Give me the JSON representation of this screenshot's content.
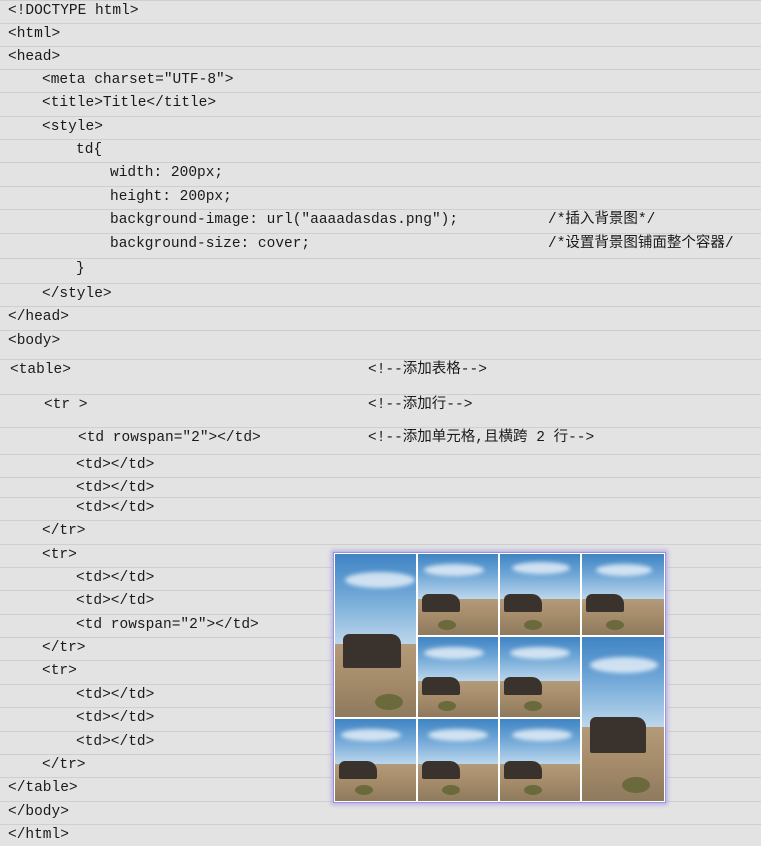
{
  "code_lines": [
    {
      "text": "<!DOCTYPE html>"
    },
    {
      "text": "<html>"
    },
    {
      "text": "<head>"
    },
    {
      "text": "<meta charset=\"UTF-8\">"
    },
    {
      "text": "<title>Title</title>"
    },
    {
      "text": "<style>"
    },
    {
      "text": "td{"
    },
    {
      "text": "width: 200px;"
    },
    {
      "text": "height: 200px;"
    },
    {
      "text": "background-image: url(\"aaaadasdas.png\");",
      "comment": "/*插入背景图*/"
    },
    {
      "text": "background-size: cover;",
      "comment": "/*设置背景图铺面整个容器/"
    },
    {
      "text": "}"
    },
    {
      "text": "</style>"
    },
    {
      "text": "</head>"
    },
    {
      "text": "<body>"
    },
    {
      "text": "<table>",
      "comment": "<!--添加表格-->"
    },
    {
      "text": "<tr >",
      "comment": "<!--添加行-->"
    },
    {
      "text": "<td rowspan=\"2\"></td>",
      "comment": "<!--添加单元格,且横跨 2 行-->"
    },
    {
      "text": "<td></td>"
    },
    {
      "text": "<td></td>"
    },
    {
      "text": "<td></td>"
    },
    {
      "text": "</tr>"
    },
    {
      "text": "<tr>"
    },
    {
      "text": "<td></td>"
    },
    {
      "text": "<td></td>"
    },
    {
      "text": "<td rowspan=\"2\"></td>"
    },
    {
      "text": "</tr>"
    },
    {
      "text": "<tr>"
    },
    {
      "text": "<td></td>"
    },
    {
      "text": "<td></td>"
    },
    {
      "text": "<td></td>"
    },
    {
      "text": "</tr>"
    },
    {
      "text": "</table>"
    },
    {
      "text": "</body>"
    },
    {
      "text": "</html>"
    }
  ],
  "preview": {
    "image_subject": "desert-landscape",
    "accent_border": "#9d94d8"
  }
}
